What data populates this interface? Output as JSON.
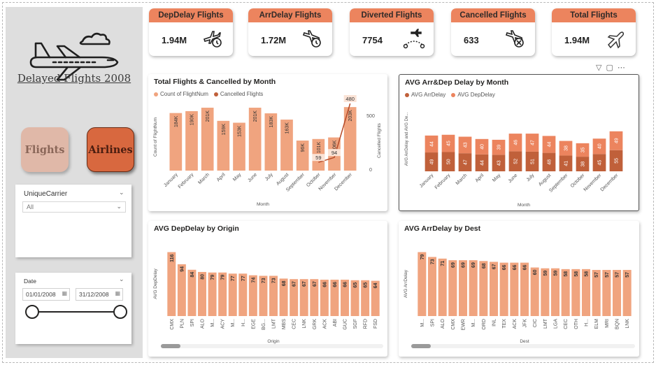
{
  "sidebar": {
    "title": "Delayed Flights 2008",
    "nav": {
      "flights": "Flights",
      "airlines": "Airlines"
    },
    "carrier_slicer": {
      "title": "UniqueCarrier",
      "value": "All"
    },
    "date_slicer": {
      "title": "Date",
      "start": "01/01/2008",
      "end": "31/12/2008"
    }
  },
  "kpis": [
    {
      "title": "DepDelay Flights",
      "value": "1.94M",
      "icon": "plane-clock-icon"
    },
    {
      "title": "ArrDelay Flights",
      "value": "1.72M",
      "icon": "plane-clock-icon"
    },
    {
      "title": "Diverted Flights",
      "value": "7754",
      "icon": "plane-route-icon"
    },
    {
      "title": "Cancelled Flights",
      "value": "633",
      "icon": "plane-cancel-icon"
    },
    {
      "title": "Total Flights",
      "value": "1.94M",
      "icon": "plane-icon"
    }
  ],
  "colors": {
    "accent": "#ec845e",
    "bar_light": "#f0a47f",
    "bar_dark": "#c0603a",
    "line": "#b54a28"
  },
  "chart_data": [
    {
      "type": "bar",
      "title": "Total Flights & Cancelled by Month",
      "xlabel": "Month",
      "ylabel": "Count of FlightNum",
      "y2label": "Cancelled Flights",
      "legend": [
        "Count of FlightNum",
        "Cancelled Flights"
      ],
      "y2ticks": [
        "500",
        "0"
      ],
      "categories": [
        "January",
        "February",
        "March",
        "April",
        "May",
        "June",
        "July",
        "August",
        "September",
        "October",
        "November",
        "December"
      ],
      "series": [
        {
          "name": "Count of FlightNum",
          "values": [
            184,
            190,
            201,
            159,
            153,
            201,
            183,
            163,
            96,
            101,
            106,
            203
          ],
          "labels": [
            "184K",
            "190K",
            "201K",
            "159K",
            "153K",
            "201K",
            "183K",
            "163K",
            "96K",
            "101K",
            "106K",
            "203K"
          ]
        },
        {
          "name": "Cancelled Flights",
          "type": "line",
          "values": [
            null,
            null,
            null,
            null,
            null,
            null,
            null,
            null,
            null,
            59,
            94,
            480
          ],
          "labels": [
            "",
            "",
            "",
            "",
            "",
            "",
            "",
            "",
            "",
            "59",
            "94",
            "480"
          ]
        }
      ]
    },
    {
      "type": "bar",
      "title": "AVG Arr&Dep Delay by Month",
      "xlabel": "Month",
      "ylabel": "AVG ArrDelay and AVG De...",
      "legend": [
        "AVG ArrDelay",
        "AVG DepDelay"
      ],
      "categories": [
        "January",
        "February",
        "March",
        "April",
        "May",
        "June",
        "July",
        "August",
        "September",
        "October",
        "November",
        "December"
      ],
      "series": [
        {
          "name": "AVG ArrDelay",
          "values": [
            49,
            50,
            47,
            44,
            43,
            52,
            51,
            48,
            41,
            38,
            45,
            55
          ]
        },
        {
          "name": "AVG DepDelay",
          "values": [
            44,
            45,
            43,
            40,
            39,
            46,
            47,
            44,
            38,
            35,
            40,
            49
          ]
        }
      ]
    },
    {
      "type": "bar",
      "title": "AVG DepDelay by Origin",
      "xlabel": "Origin",
      "ylabel": "AVG DepDelay",
      "categories": [
        "CMX",
        "PLN",
        "SPI",
        "ALO",
        "M...",
        "ACY",
        "M...",
        "H...",
        "EGE",
        "BG...",
        "LMT",
        "MBS",
        "CEC",
        "LNK",
        "GRK",
        "ACK",
        "ABI",
        "GUC",
        "SGF",
        "RFD",
        "FSD"
      ],
      "values": [
        116,
        94,
        84,
        80,
        79,
        79,
        77,
        77,
        74,
        73,
        73,
        68,
        67,
        67,
        67,
        66,
        66,
        66,
        65,
        65,
        64
      ]
    },
    {
      "type": "bar",
      "title": "AVG ArrDelay by Dest",
      "xlabel": "Dest",
      "ylabel": "AVG ArrDelay",
      "categories": [
        "M...",
        "SPI",
        "ALO",
        "CMX",
        "EWR",
        "M...",
        "ORD",
        "INL",
        "TEX",
        "ACK",
        "JFK",
        "CIC",
        "LMT",
        "LGA",
        "CEC",
        "OTH",
        "H...",
        "ELM",
        "MRI",
        "BQN",
        "LNK"
      ],
      "values": [
        79,
        73,
        71,
        69,
        69,
        69,
        68,
        67,
        66,
        66,
        66,
        60,
        59,
        59,
        58,
        58,
        58,
        57,
        57,
        57,
        57
      ]
    }
  ]
}
